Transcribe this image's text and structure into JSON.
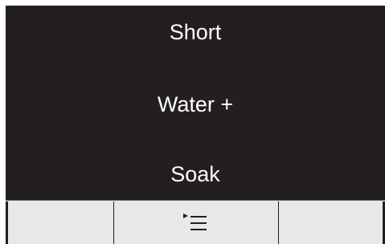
{
  "display": {
    "options": [
      "Short",
      "Water +",
      "Soak"
    ]
  },
  "softkeys": {
    "left": {
      "label": ""
    },
    "middle": {
      "icon": "menu-list-icon"
    },
    "right": {
      "label": ""
    }
  },
  "colors": {
    "screen_background": "#231f20",
    "text": "#ffffff",
    "softkey_background": "#e8e8e8"
  }
}
